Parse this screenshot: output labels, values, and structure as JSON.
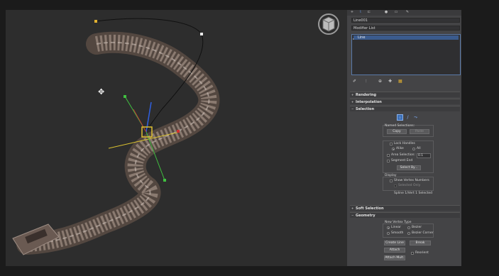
{
  "viewport": {
    "name": "3d-viewport",
    "move_cursor_glyph": "✥"
  },
  "panel": {
    "toolbar_icons": [
      "+",
      "⌇",
      "⊏",
      "●",
      "▭",
      "✎"
    ],
    "object_name": "Line001",
    "modifier_list": "Modifier List",
    "stack_item": "Line",
    "stack_tools": [
      "✐",
      "⫶",
      "⊕",
      "✚",
      "▦"
    ],
    "rollouts": {
      "rendering": "Rendering",
      "interpolation": "Interpolation",
      "selection": "Selection",
      "soft_selection": "Soft Selection",
      "geometry": "Geometry"
    },
    "selection": {
      "named_selections": "Named Selections:",
      "copy": "Copy",
      "paste": "Paste",
      "lock_handles": "Lock Handles",
      "alike": "Alike",
      "all": "All",
      "area_selection": "Area Selection:",
      "area_value": "0.1",
      "segment_end": "Segment End",
      "select_by": "Select By...",
      "display": "Display",
      "show_vertex_numbers": "Show Vertex Numbers",
      "selected_only": "Selected Only",
      "status": "Spline 1/Vert 1 Selected"
    },
    "geometry": {
      "new_vertex_type": "New Vertex Type",
      "linear": "Linear",
      "bezier": "Bezier",
      "smooth": "Smooth",
      "bezier_corner": "Bezier Corner",
      "create_line": "Create Line",
      "break": "Break",
      "attach": "Attach",
      "reorient": "Reorient",
      "attach_mult": "Attach Mult."
    }
  }
}
